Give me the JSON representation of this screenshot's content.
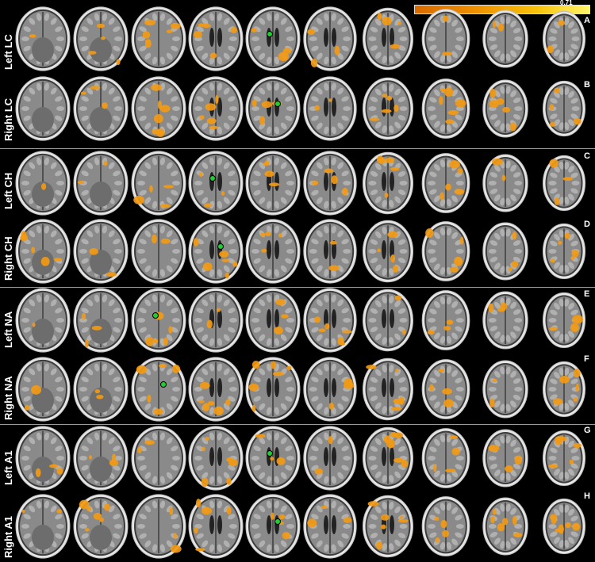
{
  "colorbar": {
    "max_label": "0.71",
    "colors": [
      "#d86a00",
      "#ee9000",
      "#f7c20a",
      "#fff56a"
    ]
  },
  "rows": [
    {
      "label": "Left LC",
      "letter": "A",
      "seed_slice": 4
    },
    {
      "label": "Right LC",
      "letter": "B",
      "seed_slice": 4
    },
    {
      "label": "Left CH",
      "letter": "C",
      "seed_slice": 3
    },
    {
      "label": "Right CH",
      "letter": "D",
      "seed_slice": 3
    },
    {
      "label": "Left NA",
      "letter": "E",
      "seed_slice": 2
    },
    {
      "label": "Right NA",
      "letter": "F",
      "seed_slice": 2
    },
    {
      "label": "Left A1",
      "letter": "G",
      "seed_slice": 4
    },
    {
      "label": "Right A1",
      "letter": "H",
      "seed_slice": 4
    }
  ],
  "slices_per_row": 10,
  "activation_color": "#f29a14",
  "seed_marker_color": "#22cc33"
}
